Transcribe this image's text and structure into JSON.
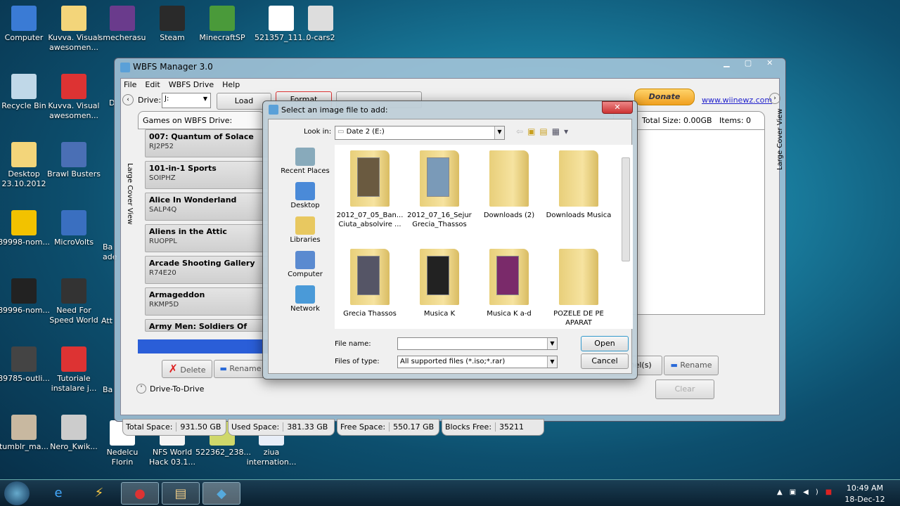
{
  "desktop": {
    "icons": [
      {
        "label": "Computer",
        "color": "#3a7bd5"
      },
      {
        "label": "Kuvva. Visual awesomen...",
        "color": "#f3d57a"
      },
      {
        "label": "smecherasu",
        "color": "#6a3b8c"
      },
      {
        "label": "Steam",
        "color": "#2a2a2a"
      },
      {
        "label": "MinecraftSP",
        "color": "#4a9a3a"
      },
      {
        "label": "521357_111...",
        "color": "#ffffff"
      },
      {
        "label": "0-cars2",
        "color": "#dddddd"
      },
      {
        "label": "Recycle Bin",
        "color": "#c0d8e8"
      },
      {
        "label": "Kuvva. Visual awesomen...",
        "color": "#d33"
      },
      {
        "label": "Desktop 23.10.2012",
        "color": "#f3d57a"
      },
      {
        "label": "Brawl Busters",
        "color": "#4a6fb5"
      },
      {
        "label": "89998-nom...",
        "color": "#f2c200"
      },
      {
        "label": "MicroVolts",
        "color": "#3a6fc0"
      },
      {
        "label": "89996-nom...",
        "color": "#222"
      },
      {
        "label": "Need For Speed World",
        "color": "#333"
      },
      {
        "label": "89785-outli...",
        "color": "#444"
      },
      {
        "label": "Tutoriale instalare j...",
        "color": "#d33"
      },
      {
        "label": "tumblr_ma...",
        "color": "#c8b8a0"
      },
      {
        "label": "Nero_Kwik...",
        "color": "#ccc"
      },
      {
        "label": "Nedelcu Florin",
        "color": "#fff"
      },
      {
        "label": "NFS World Hack 03.1...",
        "color": "#f4f4f4"
      },
      {
        "label": "522362_238...",
        "color": "#cfd86a"
      },
      {
        "label": "ziua internation...",
        "color": "#e8eef8"
      }
    ],
    "partial": [
      "D",
      "Ba ade",
      "Att",
      "Ba"
    ]
  },
  "app": {
    "title": "WBFS Manager 3.0",
    "menu": [
      "File",
      "Edit",
      "WBFS Drive",
      "Help"
    ],
    "drive_label": "Drive:",
    "drive_value": "J:",
    "load": "Load",
    "format": "Format",
    "games_header": "Games on WBFS Drive:",
    "donate": "Donate",
    "link": "www.wiinewz.com",
    "total_size_label": "Total Size:",
    "total_size": "0.00GB",
    "items_label": "Items:",
    "items": "0",
    "side_label": "Large Cover View",
    "games": [
      {
        "name": "007: Quantum of Solace",
        "id": "RJ2P52"
      },
      {
        "name": "101-in-1 Sports",
        "id": "SOIPHZ"
      },
      {
        "name": "Alice In Wonderland",
        "id": "SALP4Q"
      },
      {
        "name": "Aliens in the Attic",
        "id": "RUOPPL"
      },
      {
        "name": "Arcade Shooting Gallery",
        "id": "R74E20"
      },
      {
        "name": "Armageddon",
        "id": "RKMP5D"
      },
      {
        "name": "Army Men: Soldiers Of Misfortune",
        "id": ""
      }
    ],
    "delete": "Delete",
    "rename": "Rename",
    "channels": "Channel(s)",
    "rename2": "Rename",
    "clear": "Clear",
    "drive_to_drive": "Drive-To-Drive",
    "stats": [
      {
        "label": "Total Space:",
        "value": "931.50 GB"
      },
      {
        "label": "Used Space:",
        "value": "381.33 GB"
      },
      {
        "label": "Free Space:",
        "value": "550.17 GB"
      },
      {
        "label": "Blocks Free:",
        "value": "35211"
      }
    ]
  },
  "dialog": {
    "title": "Select an image file to add:",
    "look_in_label": "Look in:",
    "look_in": "Date 2 (E:)",
    "places": [
      "Recent Places",
      "Desktop",
      "Libraries",
      "Computer",
      "Network"
    ],
    "folders": [
      "2012_07_05_Ban... Ciuta_absolvire ...",
      "2012_07_16_Sejur Grecia_Thassos",
      "Downloads (2)",
      "Downloads Musica",
      "Grecia Thassos",
      "Musica K",
      "Musica K a-d",
      "POZELE DE PE APARAT"
    ],
    "file_name_label": "File name:",
    "file_name": "",
    "files_of_type_label": "Files of type:",
    "files_of_type": "All supported files (*.iso;*.rar)",
    "open": "Open",
    "cancel": "Cancel"
  },
  "taskbar": {
    "time": "10:49 AM",
    "date": "18-Dec-12"
  }
}
